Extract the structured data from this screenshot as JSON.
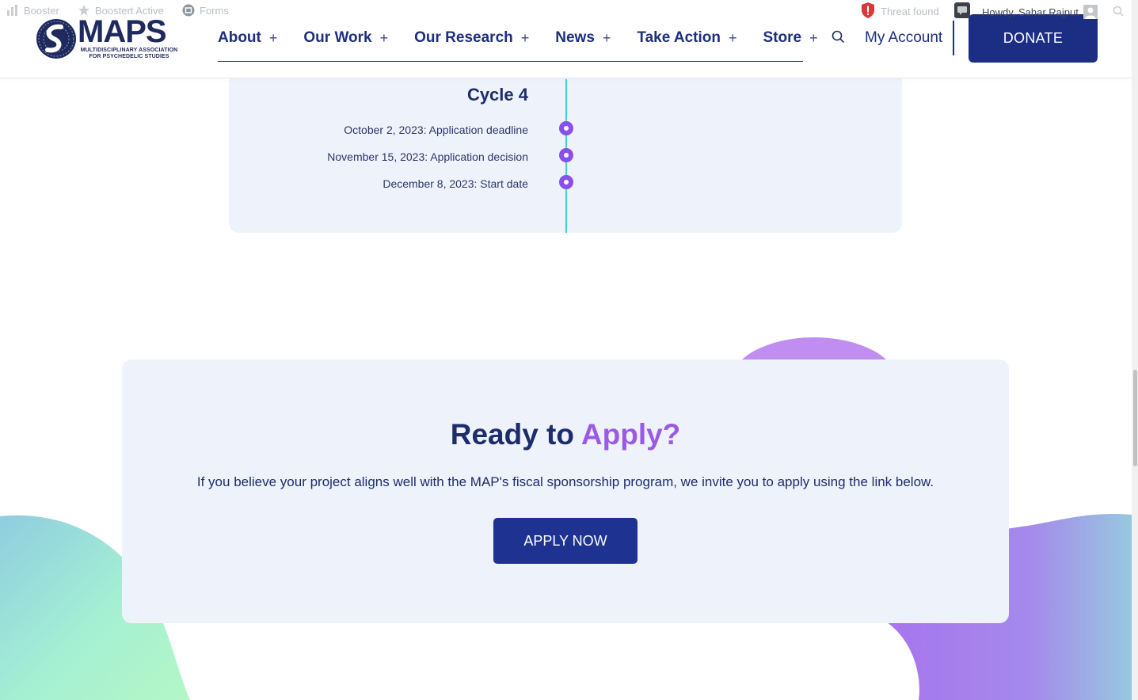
{
  "adminbar": {
    "booster": "Booster",
    "booster_active": "Boostert Active",
    "forms": "Forms",
    "threat": "Threat found",
    "howdy": "Howdy, Sahar Rajput"
  },
  "header": {
    "logo_text": "MAPS",
    "logo_sub_line1": "MULTIDISCIPLINARY ASSOCIATION",
    "logo_sub_line2": "FOR PSYCHEDELIC STUDIES",
    "nav": [
      {
        "label": "About"
      },
      {
        "label": "Our Work"
      },
      {
        "label": "Our Research"
      },
      {
        "label": "News"
      },
      {
        "label": "Take Action"
      },
      {
        "label": "Store"
      }
    ],
    "nav_plus": "+",
    "my_account": "My Account",
    "donate": "DONATE"
  },
  "timeline": {
    "title": "Cycle 4",
    "items": [
      {
        "text": "October 2, 2023: Application deadline"
      },
      {
        "text": "November 15, 2023: Application decision"
      },
      {
        "text": "December 8, 2023: Start date"
      }
    ]
  },
  "apply": {
    "title_part1": "Ready to ",
    "title_part2": "Apply?",
    "text": "If you believe your project aligns well with the MAP's fiscal sponsorship program, we invite you to apply using the link below.",
    "button": "APPLY NOW"
  },
  "colors": {
    "brand_navy": "#1c2d84",
    "accent_purple": "#9b5ae6",
    "timeline_teal": "#3fd3d6",
    "card_bg": "#eef3fb"
  }
}
